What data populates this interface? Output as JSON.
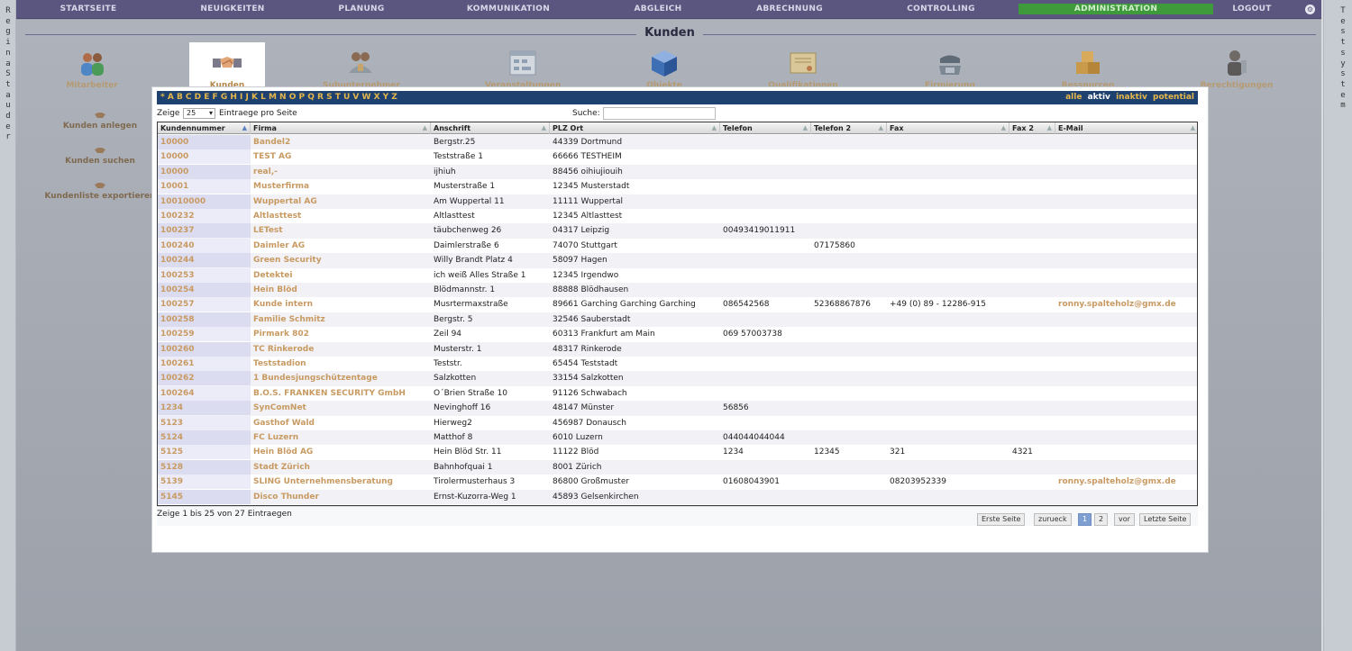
{
  "left_user": "Regina Stauder",
  "right_system": "Testsystem",
  "nav": [
    {
      "label": "STARTSEITE",
      "active": false
    },
    {
      "label": "NEUIGKEITEN",
      "active": false
    },
    {
      "label": "PLANUNG",
      "active": false
    },
    {
      "label": "KOMMUNIKATION",
      "active": false
    },
    {
      "label": "ABGLEICH",
      "active": false
    },
    {
      "label": "ABRECHNUNG",
      "active": false
    },
    {
      "label": "CONTROLLING",
      "active": false
    },
    {
      "label": "ADMINISTRATION",
      "active": true
    },
    {
      "label": "LOGOUT",
      "active": false
    }
  ],
  "page_title": "Kunden",
  "tabs": [
    {
      "label": "Mitarbeiter",
      "icon": "people-icon"
    },
    {
      "label": "Kunden",
      "icon": "handshake-icon",
      "active": true
    },
    {
      "label": "Subunternehmer",
      "icon": "subcontractor-icon"
    },
    {
      "label": "Veranstaltungen",
      "icon": "calendar-icon"
    },
    {
      "label": "Objekte",
      "icon": "cube-icon"
    },
    {
      "label": "Qualifikationen",
      "icon": "certificate-icon"
    },
    {
      "label": "Firmierung",
      "icon": "telephone-icon"
    },
    {
      "label": "Ressourcen",
      "icon": "boxes-icon"
    },
    {
      "label": "Berechtigungen",
      "icon": "user-key-icon"
    }
  ],
  "actions": [
    {
      "label": "Kunden anlegen"
    },
    {
      "label": "Kunden suchen"
    },
    {
      "label": "Kundenliste exportieren"
    }
  ],
  "letters": "* A B C D E F G H I J K L M N O P Q R S T U V W X Y Z",
  "filters": {
    "alle": "alle",
    "aktiv": "aktiv",
    "inaktiv": "inaktiv",
    "potential": "potential"
  },
  "controls": {
    "show_prefix": "Zeige",
    "page_size": "25",
    "show_suffix": "Eintraege pro Seite",
    "search_label": "Suche:"
  },
  "columns": [
    "Kundennummer",
    "Firma",
    "Anschrift",
    "PLZ Ort",
    "Telefon",
    "Telefon 2",
    "Fax",
    "Fax 2",
    "E-Mail"
  ],
  "rows": [
    [
      "10000",
      "Bandel2",
      "Bergstr.25",
      "44339 Dortmund",
      "",
      "",
      "",
      "",
      ""
    ],
    [
      "10000",
      "TEST AG",
      "Teststraße 1",
      "66666 TESTHEIM",
      "",
      "",
      "",
      "",
      ""
    ],
    [
      "10000",
      "real,-",
      "ijhiuh",
      "88456 oihiujiouih",
      "",
      "",
      "",
      "",
      ""
    ],
    [
      "10001",
      "Musterfirma",
      "Musterstraße 1",
      "12345 Musterstadt",
      "",
      "",
      "",
      "",
      ""
    ],
    [
      "10010000",
      "Wuppertal AG",
      "Am Wuppertal 11",
      "11111 Wuppertal",
      "",
      "",
      "",
      "",
      ""
    ],
    [
      "100232",
      "Altlasttest",
      "Altlasttest",
      "12345 Altlasttest",
      "",
      "",
      "",
      "",
      ""
    ],
    [
      "100237",
      "LETest",
      "täubchenweg 26",
      "04317 Leipzig",
      "00493419011911",
      "",
      "",
      "",
      ""
    ],
    [
      "100240",
      "Daimler AG",
      "Daimlerstraße 6",
      "74070 Stuttgart",
      "",
      "07175860",
      "",
      "",
      ""
    ],
    [
      "100244",
      "Green Security",
      "Willy Brandt Platz 4",
      "58097 Hagen",
      "",
      "",
      "",
      "",
      ""
    ],
    [
      "100253",
      "Detektei",
      "ich weiß Alles Straße 1",
      "12345 Irgendwo",
      "",
      "",
      "",
      "",
      ""
    ],
    [
      "100254",
      "Hein Blöd",
      "Blödmannstr. 1",
      "88888 Blödhausen",
      "",
      "",
      "",
      "",
      ""
    ],
    [
      "100257",
      "Kunde intern",
      "Musrtermaxstraße",
      "89661 Garching Garching Garching",
      "086542568",
      "52368867876",
      "+49 (0) 89 - 12286-915",
      "",
      "ronny.spalteholz@gmx.de"
    ],
    [
      "100258",
      "Familie Schmitz",
      "Bergstr. 5",
      "32546 Sauberstadt",
      "",
      "",
      "",
      "",
      ""
    ],
    [
      "100259",
      "Pirmark 802",
      "Zeil 94",
      "60313 Frankfurt am Main",
      "069 57003738",
      "",
      "",
      "",
      ""
    ],
    [
      "100260",
      "TC Rinkerode",
      "Musterstr. 1",
      "48317 Rinkerode",
      "",
      "",
      "",
      "",
      ""
    ],
    [
      "100261",
      "Teststadion",
      "Teststr.",
      "65454 Teststadt",
      "",
      "",
      "",
      "",
      ""
    ],
    [
      "100262",
      "1 Bundesjungschützentage",
      "Salzkotten",
      "33154 Salzkotten",
      "",
      "",
      "",
      "",
      ""
    ],
    [
      "100264",
      "B.O.S. FRANKEN SECURITY GmbH",
      "O´Brien Straße 10",
      "91126 Schwabach",
      "",
      "",
      "",
      "",
      ""
    ],
    [
      "1234",
      "SynComNet",
      "Nevinghoff 16",
      "48147 Münster",
      "56856",
      "",
      "",
      "",
      ""
    ],
    [
      "5123",
      "Gasthof Wald",
      "Hierweg2",
      "456987 Donausch",
      "",
      "",
      "",
      "",
      ""
    ],
    [
      "5124",
      "FC Luzern",
      "Matthof 8",
      "6010 Luzern",
      "044044044044",
      "",
      "",
      "",
      ""
    ],
    [
      "5125",
      "Hein Blöd AG",
      "Hein Blöd Str. 11",
      "11122 Blöd",
      "1234",
      "12345",
      "321",
      "4321",
      ""
    ],
    [
      "5128",
      "Stadt Zürich",
      "Bahnhofquai 1",
      "8001 Zürich",
      "",
      "",
      "",
      "",
      ""
    ],
    [
      "5139",
      "SLING Unternehmensberatung",
      "Tirolermusterhaus 3",
      "86800 Großmuster",
      "01608043901",
      "",
      "08203952339",
      "",
      "ronny.spalteholz@gmx.de"
    ],
    [
      "5145",
      "Disco Thunder",
      "Ernst-Kuzorra-Weg 1",
      "45893 Gelsenkirchen",
      "",
      "",
      "",
      "",
      ""
    ]
  ],
  "footer": {
    "info": "Zeige 1 bis 25 von 27 Eintraegen",
    "first": "Erste Seite",
    "prev": "zurueck",
    "page1": "1",
    "page2": "2",
    "next": "vor",
    "last": "Letzte Seite"
  },
  "colors": {
    "nav_bg": "#5a5680",
    "active_nav": "#3e9a3a",
    "letter_bar": "#1e4170",
    "link": "#c89a62"
  }
}
